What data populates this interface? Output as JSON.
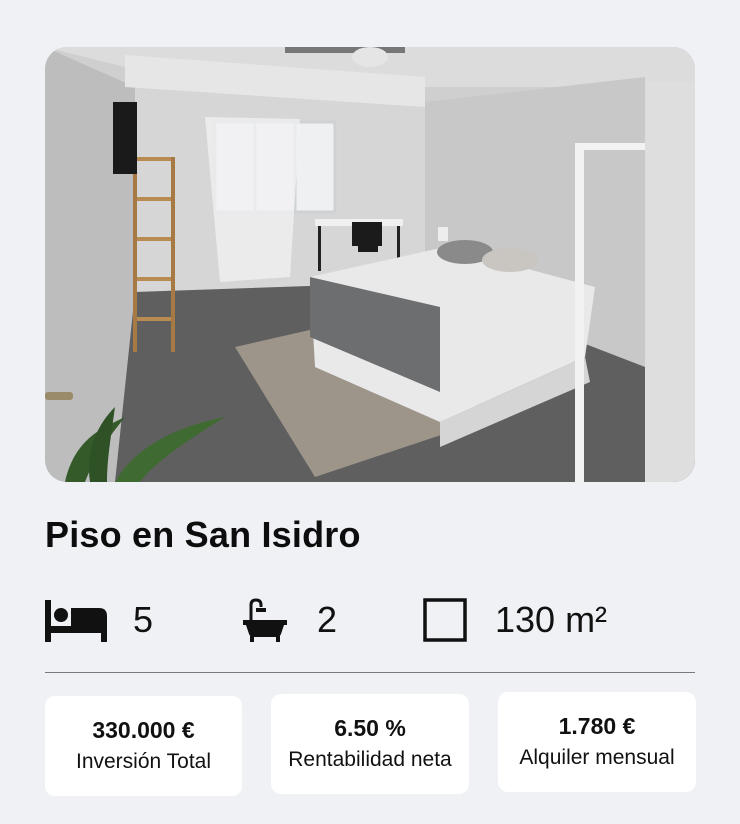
{
  "listing": {
    "title": "Piso en San Isidro",
    "photo_alt": "bedroom photo",
    "features": {
      "bedrooms": "5",
      "bathrooms": "2",
      "area": "130 m²"
    },
    "stats": [
      {
        "amount": "330.000 €",
        "label": "Inversión Total"
      },
      {
        "amount": "6.50 %",
        "label": "Rentabilidad neta"
      },
      {
        "amount": "1.780 €",
        "label": "Alquiler mensual"
      }
    ]
  },
  "icons": {
    "bedrooms": "bed-icon",
    "bathrooms": "bathtub-icon",
    "area": "square-area-icon"
  },
  "colors": {
    "background": "#eff1f5",
    "card": "#ffffff",
    "text": "#111111",
    "divider": "#7a7a7a"
  }
}
